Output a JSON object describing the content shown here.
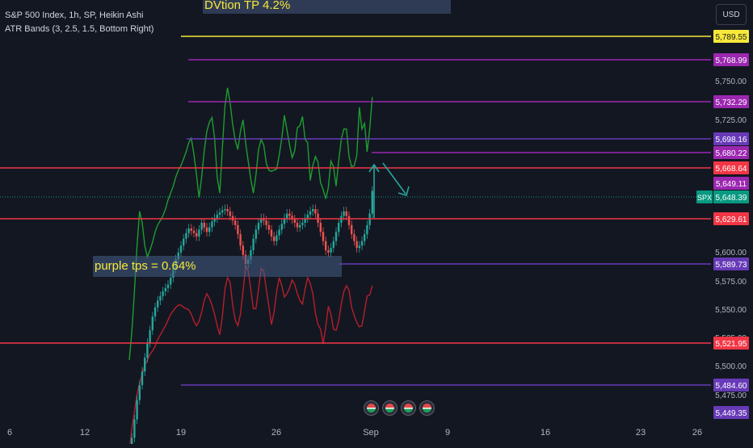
{
  "header": {
    "title": "S&P 500 Index, 1h, SP, Heikin Ashi",
    "indicator": "ATR Bands (3, 2.5, 1.5, Bottom Right)"
  },
  "currency_button": "USD",
  "annotations": {
    "banner_text": "DVtion TP 4.2%",
    "purple_text": "purple tps = 0.64%"
  },
  "colors": {
    "background": "#131722",
    "up_candle": "#26a69a",
    "down_candle": "#ef5350",
    "upper_band": "#1e9e2e",
    "lower_band": "#b51f2a",
    "red_level": "#f23645",
    "purple_level": "#9c27b0",
    "violet_level": "#673ab7",
    "yellow_level": "#f7e83a",
    "arrow": "#26a69a",
    "current_price": "#089981"
  },
  "chart_data": {
    "type": "candlestick",
    "symbol": "SPX",
    "timeframe": "1h",
    "ylim": [
      5440,
      5800
    ],
    "x_ticks": [
      "6",
      "12",
      "19",
      "26",
      "Sep",
      "9",
      "16",
      "23",
      "26"
    ],
    "y_ticks": [
      "5,750.00",
      "5,725.00",
      "5,600.00",
      "5,575.00",
      "5,550.00",
      "5,525.00",
      "5,500.00",
      "5,475.00"
    ],
    "current_price": {
      "label": "SPX",
      "value": "5,648.39"
    },
    "levels": [
      {
        "value": 5789.55,
        "label": "5,789.55",
        "color": "yellow"
      },
      {
        "value": 5768.99,
        "label": "5,768.99",
        "color": "purple"
      },
      {
        "value": 5732.29,
        "label": "5,732.29",
        "color": "purple"
      },
      {
        "value": 5698.16,
        "label": "5,698.16",
        "color": "violet"
      },
      {
        "value": 5680.22,
        "label": "5,680.22",
        "color": "purple"
      },
      {
        "value": 5668.64,
        "label": "5,668.64",
        "color": "red"
      },
      {
        "value": 5649.11,
        "label": "5,649.11",
        "color": "purple"
      },
      {
        "value": 5629.61,
        "label": "5,629.61",
        "color": "red"
      },
      {
        "value": 5589.73,
        "label": "5,589.73",
        "color": "violet"
      },
      {
        "value": 5521.95,
        "label": "5,521.95",
        "color": "red"
      },
      {
        "value": 5484.6,
        "label": "5,484.60",
        "color": "violet"
      },
      {
        "value": 5449.35,
        "label": "5,449.35",
        "color": "violet"
      }
    ],
    "closes": [
      5418,
      5432,
      5448,
      5465,
      5478,
      5490,
      5502,
      5515,
      5526,
      5538,
      5546,
      5552,
      5556,
      5560,
      5563,
      5566,
      5572,
      5580,
      5588,
      5594,
      5600,
      5606,
      5611,
      5615,
      5613,
      5611,
      5608,
      5614,
      5620,
      5616,
      5612,
      5616,
      5621,
      5624,
      5627,
      5629,
      5631,
      5632,
      5630,
      5626,
      5622,
      5618,
      5610,
      5600,
      5592,
      5584,
      5588,
      5596,
      5606,
      5614,
      5620,
      5624,
      5622,
      5618,
      5614,
      5608,
      5604,
      5609,
      5614,
      5619,
      5624,
      5628,
      5626,
      5623,
      5620,
      5616,
      5618,
      5620,
      5624,
      5627,
      5630,
      5632,
      5628,
      5620,
      5612,
      5604,
      5596,
      5594,
      5598,
      5604,
      5612,
      5620,
      5626,
      5630,
      5626,
      5618,
      5610,
      5604,
      5598,
      5600,
      5604,
      5610,
      5618,
      5628,
      5648
    ],
    "upper_band": [
      5500,
      5525,
      5560,
      5600,
      5630,
      5620,
      5600,
      5590,
      5596,
      5603,
      5612,
      5618,
      5622,
      5626,
      5632,
      5640,
      5646,
      5652,
      5660,
      5666,
      5670,
      5676,
      5682,
      5690,
      5694,
      5680,
      5662,
      5642,
      5660,
      5683,
      5700,
      5708,
      5712,
      5694,
      5660,
      5646,
      5685,
      5722,
      5738,
      5725,
      5706,
      5692,
      5684,
      5700,
      5710,
      5690,
      5674,
      5658,
      5646,
      5662,
      5684,
      5693,
      5688,
      5672,
      5666,
      5665,
      5666,
      5667,
      5679,
      5694,
      5714,
      5701,
      5688,
      5677,
      5683,
      5703,
      5705,
      5713,
      5693,
      5690,
      5657,
      5670,
      5678,
      5673,
      5655,
      5649,
      5641,
      5651,
      5674,
      5669,
      5652,
      5674,
      5693,
      5702,
      5702,
      5678,
      5669,
      5670,
      5679,
      5721,
      5702,
      5707,
      5682,
      5702,
      5730
    ],
    "lower_band": [
      5420,
      5440,
      5455,
      5470,
      5480,
      5488,
      5495,
      5500,
      5505,
      5508,
      5512,
      5518,
      5522,
      5526,
      5530,
      5535,
      5540,
      5543,
      5546,
      5548,
      5548,
      5546,
      5545,
      5544,
      5540,
      5534,
      5530,
      5534,
      5542,
      5552,
      5558,
      5554,
      5548,
      5540,
      5530,
      5522,
      5538,
      5562,
      5572,
      5568,
      5548,
      5535,
      5530,
      5540,
      5560,
      5582,
      5578,
      5562,
      5545,
      5545,
      5562,
      5580,
      5578,
      5562,
      5547,
      5531,
      5542,
      5560,
      5572,
      5565,
      5555,
      5558,
      5563,
      5570,
      5566,
      5558,
      5552,
      5549,
      5562,
      5572,
      5567,
      5558,
      5541,
      5531,
      5527,
      5514,
      5529,
      5547,
      5540,
      5527,
      5526,
      5534,
      5549,
      5560,
      5565,
      5561,
      5546,
      5539,
      5533,
      5529,
      5530,
      5543,
      5556,
      5557,
      5565
    ]
  }
}
